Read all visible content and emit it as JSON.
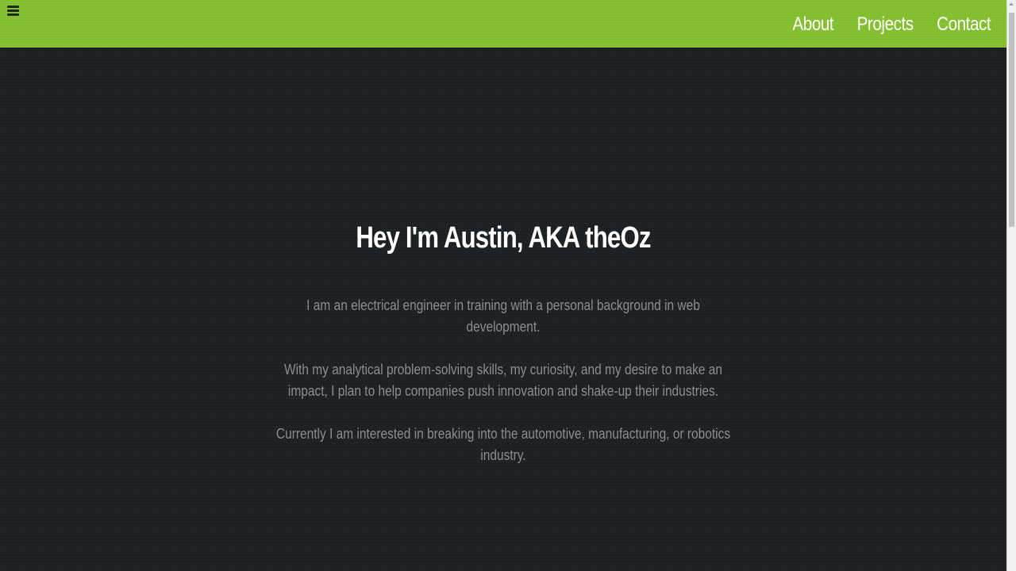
{
  "header": {
    "menu_icon": "hamburger-menu-icon",
    "nav": [
      {
        "label": "About"
      },
      {
        "label": "Projects"
      },
      {
        "label": "Contact"
      }
    ]
  },
  "hero": {
    "heading": "Hey I'm Austin, AKA theOz",
    "paragraphs": [
      "I am an electrical engineer in training with a personal background in web development.",
      "With my analytical problem-solving skills, my curiosity, and my desire to make an impact, I plan to help companies push innovation and shake-up their industries.",
      "Currently I am interested in breaking into the automotive, manufacturing, or robotics industry."
    ]
  },
  "colors": {
    "accent": "#87c232",
    "background": "#1f2326",
    "heading": "#ffffff",
    "body_text": "#8a8e91"
  }
}
